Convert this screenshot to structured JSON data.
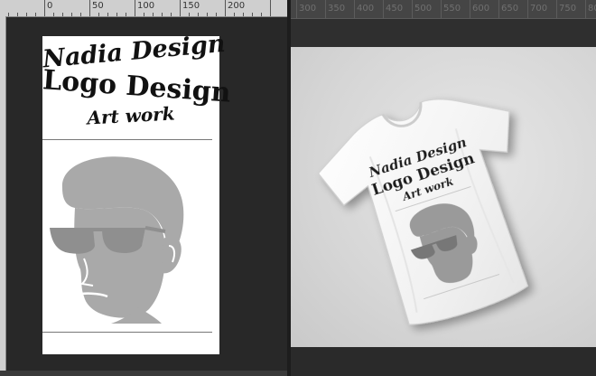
{
  "left_document": {
    "ruler_labels": [
      "0",
      "50",
      "100",
      "150",
      "200"
    ],
    "artboard": {
      "line1": "Nadia Design",
      "line2": "Logo Design",
      "line3": "Art work"
    }
  },
  "right_document": {
    "ruler_labels": [
      "300",
      "350",
      "400",
      "450",
      "500",
      "550",
      "600",
      "650",
      "700",
      "750",
      "800"
    ],
    "shirt_print": {
      "line1": "Nadia Design",
      "line2": "Logo Design",
      "line3": "Art work"
    }
  },
  "colors": {
    "workspace": "#2b2b2b",
    "artboard": "#ffffff",
    "face_gray": "#a9a9a9",
    "shirt": "#f2f2f2"
  },
  "icons": {
    "portrait": "man-with-sunglasses-portrait"
  }
}
